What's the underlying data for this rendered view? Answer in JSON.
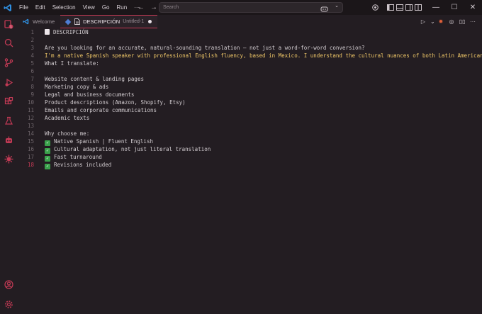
{
  "menu": [
    "File",
    "Edit",
    "Selection",
    "View",
    "Go",
    "Run",
    "···"
  ],
  "search": {
    "placeholder": "Search"
  },
  "tabs": [
    {
      "label": "Welcome"
    },
    {
      "label": "DESCRIPCIÓN",
      "sub": "Untitled-1"
    }
  ],
  "editor": {
    "lines": [
      {
        "n": "1",
        "text": "DESCRIPCIÓN"
      },
      {
        "n": "2",
        "text": ""
      },
      {
        "n": "3",
        "text": "Are you looking for an accurate, natural-sounding translation — not just a word-for-word conversion?"
      },
      {
        "n": "4",
        "text": "I'm a native Spanish speaker with professional English fluency, based in Mexico. I understand the cultural nuances of both Latin American &"
      },
      {
        "n": "5",
        "text": "What I translate:"
      },
      {
        "n": "6",
        "text": ""
      },
      {
        "n": "7",
        "text": "Website content & landing pages"
      },
      {
        "n": "8",
        "text": "Marketing copy & ads"
      },
      {
        "n": "9",
        "text": "Legal and business documents"
      },
      {
        "n": "10",
        "text": "Product descriptions (Amazon, Shopify, Etsy)"
      },
      {
        "n": "11",
        "text": "Emails and corporate communications"
      },
      {
        "n": "12",
        "text": "Academic texts"
      },
      {
        "n": "13",
        "text": ""
      },
      {
        "n": "14",
        "text": "Why choose me:"
      },
      {
        "n": "15",
        "text": "Native Spanish | Fluent English"
      },
      {
        "n": "16",
        "text": "Cultural adaptation, not just literal translation"
      },
      {
        "n": "17",
        "text": "Fast turnaround"
      },
      {
        "n": "18",
        "text": "Revisions included"
      }
    ]
  },
  "colors": {
    "accent": "#c33a55",
    "check": "#3aa14b",
    "highlight": "#f0c868"
  }
}
